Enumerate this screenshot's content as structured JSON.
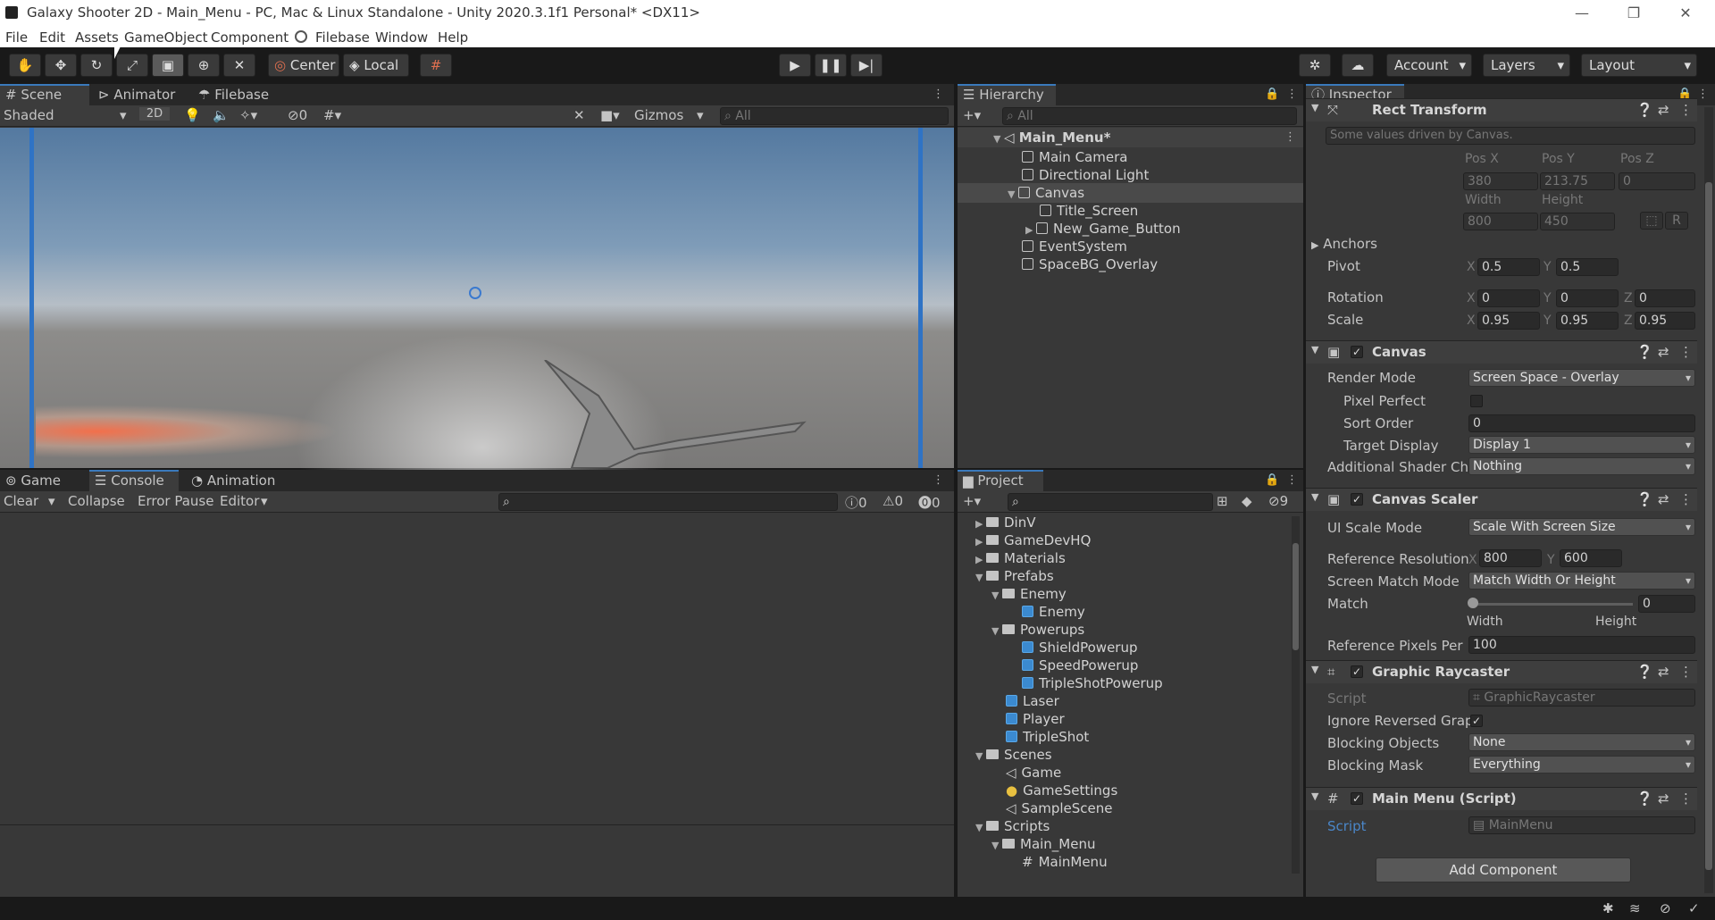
{
  "window": {
    "title": "Galaxy Shooter 2D - Main_Menu - PC, Mac & Linux Standalone - Unity 2020.3.1f1 Personal* <DX11>"
  },
  "menu": [
    "File",
    "Edit",
    "Assets",
    "GameObject",
    "Component",
    "Filebase",
    "Window",
    "Help"
  ],
  "toolbar": {
    "center": "Center",
    "local": "Local",
    "account": "Account",
    "layers": "Layers",
    "layout": "Layout"
  },
  "scene_panel": {
    "tabs": [
      "Scene",
      "Animator",
      "Filebase"
    ],
    "shading": "Shaded",
    "mode2d": "2D",
    "hidden_count": "0",
    "gizmos": "Gizmos",
    "search_placeholder": "All"
  },
  "console_panel": {
    "tabs": [
      "Game",
      "Console",
      "Animation"
    ],
    "clear": "Clear",
    "collapse": "Collapse",
    "error_pause": "Error Pause",
    "editor": "Editor",
    "info_count": "0",
    "warn_count": "0",
    "error_count": "0"
  },
  "hierarchy": {
    "tab": "Hierarchy",
    "search_placeholder": "All",
    "scene": "Main_Menu*",
    "items": [
      "Main Camera",
      "Directional Light",
      "Canvas",
      "Title_Screen",
      "New_Game_Button",
      "EventSystem",
      "SpaceBG_Overlay"
    ]
  },
  "project": {
    "tab": "Project",
    "hidden_count": "9",
    "items": [
      "DinV",
      "GameDevHQ",
      "Materials",
      "Prefabs",
      "Enemy",
      "Enemy",
      "Powerups",
      "ShieldPowerup",
      "SpeedPowerup",
      "TripleShotPowerup",
      "Laser",
      "Player",
      "TripleShot",
      "Scenes",
      "Game",
      "GameSettings",
      "SampleScene",
      "Scripts",
      "Main_Menu",
      "MainMenu"
    ]
  },
  "inspector": {
    "tab": "Inspector",
    "rect": {
      "title": "Rect Transform",
      "note": "Some values driven by Canvas.",
      "posx_label": "Pos X",
      "posy_label": "Pos Y",
      "posz_label": "Pos Z",
      "posx": "380",
      "posy": "213.75",
      "posz": "0",
      "width_label": "Width",
      "height_label": "Height",
      "width": "800",
      "height": "450",
      "r_btn": "R",
      "anchors": "Anchors",
      "pivot": "Pivot",
      "pivot_x": "0.5",
      "pivot_y": "0.5",
      "rotation": "Rotation",
      "rot_x": "0",
      "rot_y": "0",
      "rot_z": "0",
      "scale": "Scale",
      "scale_x": "0.95",
      "scale_y": "0.95",
      "scale_z": "0.95",
      "x": "X",
      "y": "Y",
      "z": "Z"
    },
    "canvas": {
      "title": "Canvas",
      "render_mode_label": "Render Mode",
      "render_mode": "Screen Space - Overlay",
      "pixel_perfect": "Pixel Perfect",
      "sort_order_label": "Sort Order",
      "sort_order": "0",
      "target_display_label": "Target Display",
      "target_display": "Display 1",
      "shader_label": "Additional Shader Cha",
      "shader": "Nothing"
    },
    "scaler": {
      "title": "Canvas Scaler",
      "scale_mode_label": "UI Scale Mode",
      "scale_mode": "Scale With Screen Size",
      "ref_res_label": "Reference Resolution",
      "ref_x": "800",
      "ref_y": "600",
      "match_mode_label": "Screen Match Mode",
      "match_mode": "Match Width Or Height",
      "match_label": "Match",
      "match_value": "0",
      "width": "Width",
      "height": "Height",
      "ref_ppu_label": "Reference Pixels Per",
      "ref_ppu": "100"
    },
    "raycaster": {
      "title": "Graphic Raycaster",
      "script_label": "Script",
      "script": "GraphicRaycaster",
      "ignore_label": "Ignore Reversed Grap",
      "blocking_objects_label": "Blocking Objects",
      "blocking_objects": "None",
      "blocking_mask_label": "Blocking Mask",
      "blocking_mask": "Everything"
    },
    "mainmenu": {
      "title": "Main Menu (Script)",
      "script_label": "Script",
      "script": "MainMenu"
    },
    "add_component": "Add Component"
  }
}
